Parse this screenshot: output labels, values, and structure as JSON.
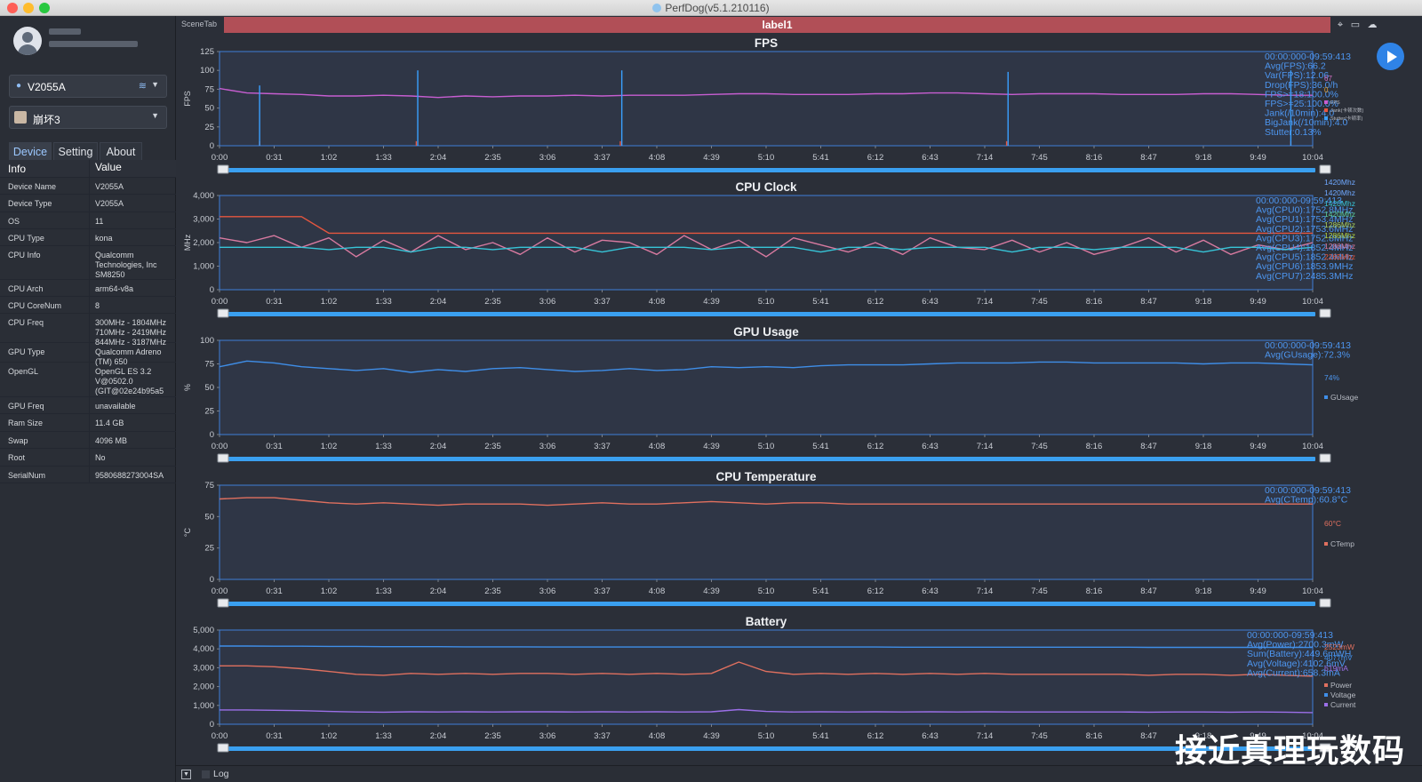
{
  "window": {
    "title": "PerfDog(v5.1.210116)"
  },
  "sidebar": {
    "device_selector": "V2055A",
    "app_selector": "崩坏3",
    "tabs": [
      "Device",
      "Setting",
      "About"
    ],
    "table_header": {
      "key": "Info",
      "value": "Value"
    },
    "rows": [
      {
        "key": "Device Name",
        "value": "V2055A"
      },
      {
        "key": "Device Type",
        "value": "V2055A"
      },
      {
        "key": "OS",
        "value": "11"
      },
      {
        "key": "CPU Type",
        "value": "kona"
      },
      {
        "key": "CPU Info",
        "value": "Qualcomm Technologies, Inc SM8250"
      },
      {
        "key": "CPU Arch",
        "value": "arm64-v8a"
      },
      {
        "key": "CPU CoreNum",
        "value": "8"
      },
      {
        "key": "CPU Freq",
        "value": "300MHz - 1804MHz 710MHz - 2419MHz 844MHz - 3187MHz"
      },
      {
        "key": "GPU Type",
        "value": "Qualcomm Adreno (TM) 650"
      },
      {
        "key": "OpenGL",
        "value": "OpenGL ES 3.2 V@0502.0 (GIT@02e24b95a5"
      },
      {
        "key": "GPU Freq",
        "value": "unavailable"
      },
      {
        "key": "Ram Size",
        "value": "11.4 GB"
      },
      {
        "key": "Swap",
        "value": "4096 MB"
      },
      {
        "key": "Root",
        "value": "No"
      },
      {
        "key": "SerialNum",
        "value": "9580688273004SA"
      }
    ]
  },
  "toolbar": {
    "scene_tab": "SceneTab",
    "label": "label1"
  },
  "bottom": {
    "log_label": "Log"
  },
  "watermark": "接近真理玩数码",
  "colors": {
    "panel_bg": "#2f3646",
    "border": "#3f7fd8",
    "slider": "#3aa0f0",
    "fps": "#c75ed1",
    "jank": "#e6563f",
    "stutter": "#3aa0ff",
    "gpu": "#3f8ee8",
    "temp": "#e0705f",
    "power": "#e0705f",
    "voltage": "#3f8ee8",
    "current": "#9b6fe8"
  },
  "chart_data": [
    {
      "type": "line",
      "title": "FPS",
      "ylabel": "FPS",
      "ylim": [
        0,
        125
      ],
      "yticks": [
        "0",
        "25",
        "50",
        "75",
        "100",
        "125"
      ],
      "xticks": [
        "0:00",
        "0:31",
        "1:02",
        "1:33",
        "2:04",
        "2:35",
        "3:06",
        "3:37",
        "4:08",
        "4:39",
        "5:10",
        "5:41",
        "6:12",
        "6:43",
        "7:14",
        "7:45",
        "8:16",
        "8:47",
        "9:18",
        "9:49",
        "10:04"
      ],
      "x_seconds": [
        0,
        30,
        60,
        90,
        120,
        150,
        180,
        210,
        240,
        270,
        300,
        330,
        360,
        390,
        420,
        450,
        480,
        510,
        540,
        570,
        600
      ],
      "series": [
        {
          "name": "FPS",
          "color": "#c75ed1",
          "values": [
            76,
            70,
            69,
            68,
            66,
            66,
            67,
            66,
            64,
            66,
            65,
            66,
            66,
            67,
            66,
            67,
            67,
            67,
            68,
            69,
            69,
            68,
            68,
            68,
            69,
            69,
            70,
            70,
            69,
            68,
            69,
            69,
            69,
            68,
            68,
            68,
            69,
            69,
            68,
            67,
            67
          ]
        },
        {
          "name": "Jank(卡顿次数)",
          "color": "#e6563f",
          "spikes": [
            {
              "x": 55,
              "v": 6
            },
            {
              "x": 270,
              "v": 6
            },
            {
              "x": 550,
              "v": 6
            },
            {
              "x": 1080,
              "v": 6
            },
            {
              "x": 1470,
              "v": 6
            }
          ]
        },
        {
          "name": "Stutter(卡顿率)",
          "color": "#3aa0ff",
          "spikes": [
            {
              "x": 55,
              "v": 80
            },
            {
              "x": 272,
              "v": 100
            },
            {
              "x": 552,
              "v": 100
            },
            {
              "x": 1082,
              "v": 98
            },
            {
              "x": 1470,
              "v": 100
            }
          ]
        }
      ],
      "legend": [
        "FPS",
        "Jank(卡顿次数)",
        "Stutter(卡顿率)"
      ],
      "current_values": [
        "67",
        "0"
      ],
      "stats": [
        "00:00:000-09:59:413",
        "Avg(FPS):66.2",
        "Var(FPS):12.06",
        "Drop(FPS):36.0/h",
        "FPS>=18:100.0%",
        "FPS>=25:100.0%",
        "Jank(/10min):4.0",
        "BigJank(/10min):4.0",
        "Stutter:0.13%"
      ]
    },
    {
      "type": "line",
      "title": "CPU Clock",
      "ylabel": "MHz",
      "ylim": [
        0,
        4000
      ],
      "yticks": [
        "0",
        "1,000",
        "2,000",
        "3,000",
        "4,000"
      ],
      "xticks": [
        "0:00",
        "0:31",
        "1:02",
        "1:33",
        "2:04",
        "2:35",
        "3:06",
        "3:37",
        "4:08",
        "4:39",
        "5:10",
        "5:41",
        "6:12",
        "6:43",
        "7:14",
        "7:45",
        "8:16",
        "8:47",
        "9:18",
        "9:49",
        "10:04"
      ],
      "series": [
        {
          "name": "CPU7",
          "color": "#e6563f",
          "values": [
            3100,
            3100,
            3100,
            3100,
            2400,
            2400,
            2400,
            2400,
            2400,
            2400,
            2400,
            2400,
            2400,
            2400,
            2400,
            2400,
            2400,
            2400,
            2400,
            2400,
            2400,
            2400,
            2400,
            2400,
            2400,
            2400,
            2400,
            2400,
            2400,
            2400,
            2400,
            2400,
            2400,
            2400,
            2400,
            2400,
            2400,
            2400,
            2400,
            2400,
            2400
          ]
        },
        {
          "name": "CPU4-6",
          "color": "#d87aa0",
          "values": [
            2200,
            2000,
            2300,
            1800,
            2200,
            1400,
            2100,
            1600,
            2300,
            1700,
            2000,
            1500,
            2200,
            1600,
            2100,
            2000,
            1500,
            2300,
            1700,
            2100,
            1400,
            2200,
            1900,
            1600,
            2000,
            1500,
            2200,
            1800,
            1700,
            2100,
            1600,
            2000,
            1500,
            1800,
            2200,
            1600,
            2100,
            1500,
            1900,
            1700,
            2000
          ]
        },
        {
          "name": "CPU0-3",
          "color": "#37c5d8",
          "values": [
            1800,
            1800,
            1800,
            1800,
            1700,
            1800,
            1800,
            1600,
            1800,
            1800,
            1700,
            1800,
            1800,
            1800,
            1600,
            1800,
            1800,
            1800,
            1700,
            1800,
            1800,
            1800,
            1600,
            1800,
            1800,
            1700,
            1800,
            1800,
            1800,
            1600,
            1800,
            1800,
            1700,
            1800,
            1800,
            1800,
            1600,
            1800,
            1800,
            1700,
            1800
          ]
        }
      ],
      "current_values": [
        {
          "text": "1420Mhz",
          "color": "#6fa8ff"
        },
        {
          "text": "1420Mhz",
          "color": "#6fa8ff"
        },
        {
          "text": "1420Mhz",
          "color": "#37c5d8"
        },
        {
          "text": "1420Mhz",
          "color": "#5bd0a0"
        },
        {
          "text": "1286Mhz",
          "color": "#a8d060"
        },
        {
          "text": "1286Mhz",
          "color": "#b0d040"
        },
        {
          "text": "1286Mhz",
          "color": "#d87aa0"
        },
        {
          "text": "2265Mhz",
          "color": "#e6563f"
        }
      ],
      "stats": [
        "00:00:000-09:59:413",
        "Avg(CPU0):1752.8MHz",
        "Avg(CPU1):1753.4MHz",
        "Avg(CPU2):1753.6MHz",
        "Avg(CPU3):1752.8MHz",
        "Avg(CPU4):1852.4MHz",
        "Avg(CPU5):1852.4MHz",
        "Avg(CPU6):1853.9MHz",
        "Avg(CPU7):2485.3MHz"
      ]
    },
    {
      "type": "line",
      "title": "GPU Usage",
      "ylabel": "%",
      "ylim": [
        0,
        100
      ],
      "yticks": [
        "0",
        "25",
        "50",
        "75",
        "100"
      ],
      "xticks": [
        "0:00",
        "0:31",
        "1:02",
        "1:33",
        "2:04",
        "2:35",
        "3:06",
        "3:37",
        "4:08",
        "4:39",
        "5:10",
        "5:41",
        "6:12",
        "6:43",
        "7:14",
        "7:45",
        "8:16",
        "8:47",
        "9:18",
        "9:49",
        "10:04"
      ],
      "series": [
        {
          "name": "GUsage",
          "color": "#3f8ee8",
          "values": [
            72,
            78,
            76,
            72,
            70,
            68,
            70,
            66,
            69,
            67,
            70,
            71,
            69,
            67,
            68,
            70,
            68,
            69,
            72,
            71,
            72,
            71,
            73,
            74,
            74,
            74,
            75,
            76,
            76,
            76,
            77,
            77,
            76,
            76,
            76,
            76,
            75,
            76,
            76,
            75,
            74
          ]
        }
      ],
      "legend": [
        "GUsage"
      ],
      "current_values": [
        "74%"
      ],
      "stats": [
        "00:00:000-09:59:413",
        "Avg(GUsage):72.3%"
      ]
    },
    {
      "type": "line",
      "title": "CPU Temperature",
      "ylabel": "°C",
      "ylim": [
        0,
        75
      ],
      "yticks": [
        "0",
        "25",
        "50",
        "75"
      ],
      "xticks": [
        "0:00",
        "0:31",
        "1:02",
        "1:33",
        "2:04",
        "2:35",
        "3:06",
        "3:37",
        "4:08",
        "4:39",
        "5:10",
        "5:41",
        "6:12",
        "6:43",
        "7:14",
        "7:45",
        "8:16",
        "8:47",
        "9:18",
        "9:49",
        "10:04"
      ],
      "series": [
        {
          "name": "CTemp",
          "color": "#e0705f",
          "values": [
            64,
            65,
            65,
            63,
            61,
            60,
            61,
            60,
            59,
            60,
            60,
            60,
            59,
            60,
            61,
            60,
            60,
            61,
            62,
            61,
            60,
            61,
            61,
            60,
            60,
            60,
            60,
            60,
            60,
            60,
            60,
            60,
            60,
            60,
            60,
            60,
            60,
            60,
            60,
            60,
            60
          ]
        }
      ],
      "legend": [
        "CTemp"
      ],
      "current_values": [
        "60°C"
      ],
      "stats": [
        "00:00:000-09:59:413",
        "Avg(CTemp):60.8°C"
      ]
    },
    {
      "type": "line",
      "title": "Battery",
      "ylim": [
        0,
        5000
      ],
      "yticks": [
        "0",
        "1,000",
        "2,000",
        "3,000",
        "4,000",
        "5,000"
      ],
      "xticks": [
        "0:00",
        "0:31",
        "1:02",
        "1:33",
        "2:04",
        "2:35",
        "3:06",
        "3:37",
        "4:08",
        "4:39",
        "5:10",
        "5:41",
        "6:12",
        "6:43",
        "7:14",
        "7:45",
        "8:16",
        "8:47",
        "9:18",
        "9:49",
        "10:04"
      ],
      "series": [
        {
          "name": "Power",
          "color": "#e0705f",
          "values": [
            3100,
            3100,
            3050,
            2950,
            2800,
            2650,
            2600,
            2700,
            2650,
            2700,
            2650,
            2700,
            2700,
            2650,
            2700,
            2650,
            2700,
            2650,
            2700,
            3300,
            2800,
            2650,
            2700,
            2650,
            2700,
            2650,
            2700,
            2650,
            2700,
            2650,
            2650,
            2650,
            2650,
            2650,
            2600,
            2650,
            2650,
            2600,
            2650,
            2600,
            2550
          ]
        },
        {
          "name": "Voltage",
          "color": "#3f8ee8",
          "values": [
            4150,
            4150,
            4140,
            4140,
            4130,
            4130,
            4120,
            4120,
            4120,
            4110,
            4110,
            4110,
            4100,
            4100,
            4100,
            4100,
            4100,
            4100,
            4100,
            4100,
            4100,
            4100,
            4100,
            4100,
            4100,
            4090,
            4090,
            4090,
            4090,
            4090,
            4090,
            4090,
            4090,
            4090,
            4080,
            4080,
            4080,
            4080,
            4080,
            4080,
            4077
          ]
        },
        {
          "name": "Current",
          "color": "#9b6fe8",
          "values": [
            760,
            760,
            740,
            720,
            680,
            650,
            640,
            660,
            650,
            660,
            650,
            660,
            660,
            650,
            660,
            650,
            660,
            650,
            660,
            780,
            680,
            650,
            660,
            650,
            660,
            650,
            660,
            650,
            660,
            650,
            650,
            650,
            650,
            650,
            640,
            650,
            650,
            640,
            650,
            640,
            619
          ]
        }
      ],
      "legend": [
        "Power",
        "Voltage",
        "Current"
      ],
      "current_values": [
        {
          "text": "2523mW",
          "color": "#e0705f"
        },
        {
          "text": "4077mV",
          "color": "#3f8ee8"
        },
        {
          "text": "619mA",
          "color": "#9b6fe8"
        }
      ],
      "stats": [
        "00:00:000-09:59:413",
        "Avg(Power):2700.3mW",
        "Sum(Battery):449.6mWH",
        "Avg(Voltage):4102.6mV",
        "Avg(Current):658.3mA"
      ]
    }
  ]
}
